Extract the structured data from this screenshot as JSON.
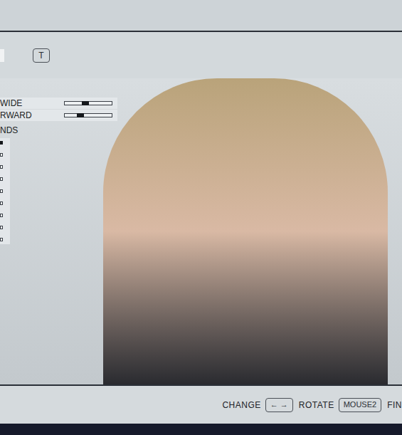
{
  "header": {
    "tab_stub": "",
    "key": "T"
  },
  "sliders": [
    {
      "label": "WIDE",
      "level": 0.44
    },
    {
      "label": "RWARD",
      "level": 0.34
    }
  ],
  "section": {
    "title": "NDS",
    "items": [
      {
        "checked": true
      },
      {
        "checked": false
      },
      {
        "checked": false
      },
      {
        "checked": false
      },
      {
        "checked": false
      },
      {
        "checked": false
      },
      {
        "checked": false
      },
      {
        "checked": false
      },
      {
        "checked": false
      }
    ]
  },
  "hints": [
    {
      "label": "CHANGE",
      "key": "← →"
    },
    {
      "label": "ROTATE",
      "key": "MOUSE2"
    },
    {
      "label": "FIN"
    }
  ]
}
